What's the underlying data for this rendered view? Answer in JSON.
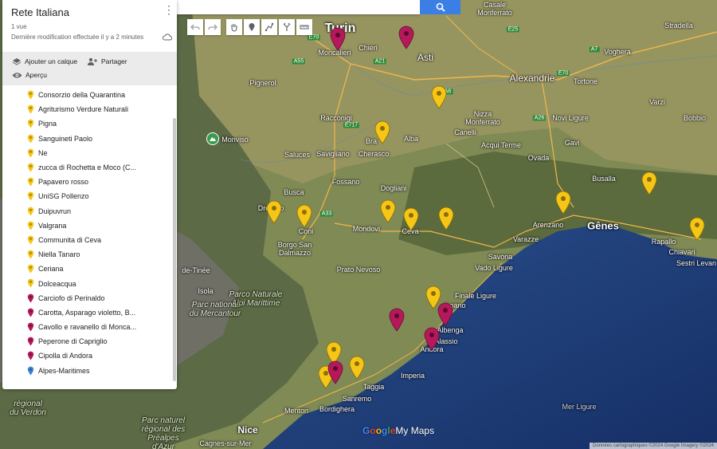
{
  "panel": {
    "title": "Rete Italiana",
    "views": "1 vue",
    "modified": "Dernière modification effectuée il y a 2 minutes",
    "actions": {
      "add_layer": "Ajouter un calque",
      "share": "Partager",
      "preview": "Aperçu"
    },
    "items": [
      {
        "label": "Consorzio della Quarantina",
        "color": "#f5c518"
      },
      {
        "label": "Agriturismo Verdure Naturali",
        "color": "#f5c518"
      },
      {
        "label": "Pigna",
        "color": "#f5c518"
      },
      {
        "label": "Sanguineti Paolo",
        "color": "#f5c518"
      },
      {
        "label": "Ne",
        "color": "#f5c518"
      },
      {
        "label": "zucca di Rochetta e Moco (C...",
        "color": "#f5c518"
      },
      {
        "label": "Papavero rosso",
        "color": "#f5c518"
      },
      {
        "label": "UniSG Pollenzo",
        "color": "#f5c518"
      },
      {
        "label": "Duipuvrun",
        "color": "#f5c518"
      },
      {
        "label": "Valgrana",
        "color": "#f5c518"
      },
      {
        "label": "Communita di Ceva",
        "color": "#f5c518"
      },
      {
        "label": "Niella Tanaro",
        "color": "#f5c518"
      },
      {
        "label": "Ceriana",
        "color": "#f5c518"
      },
      {
        "label": "Dolceacqua",
        "color": "#f5c518"
      },
      {
        "label": "Carciofo di Perinaldo",
        "color": "#b5195b"
      },
      {
        "label": "Carotta, Asparago violetto, B...",
        "color": "#b5195b"
      },
      {
        "label": "Cavollo e ravanello di Monca...",
        "color": "#b5195b"
      },
      {
        "label": "Peperone di Capriglio",
        "color": "#b5195b"
      },
      {
        "label": "Cipolla di Andora",
        "color": "#b5195b"
      },
      {
        "label": "Alpes-Maritimes",
        "color": "#3a86d4"
      }
    ]
  },
  "search": {
    "value": ""
  },
  "map": {
    "places": {
      "turin": "Turin",
      "moncalieri": "Moncalieri",
      "chieri": "Chieri",
      "asti": "Asti",
      "alexandrie": "Alexandrie",
      "casale": "Casale\nMonferrato",
      "voghera": "Voghera",
      "stradella": "Stradella",
      "tortone": "Tortone",
      "novi": "Novi Ligure",
      "varzi": "Varzi",
      "bobbio": "Bobbio",
      "gavi": "Gavi",
      "ovada": "Ovada",
      "acqui": "Acqui Terme",
      "nizza": "Nizza\nMonferrato",
      "canelli": "Canelli",
      "alba": "Alba",
      "bra": "Bra",
      "cherasco": "Cherasco",
      "racconigi": "Racconigi",
      "pignerol": "Pignerol",
      "monviso": "Monviso",
      "saluces": "Saluces",
      "savigliano": "Savigliano",
      "fossano": "Fossano",
      "busca": "Busca",
      "dronero": "Dronero",
      "coni": "Coni",
      "mondovi": "Mondovì",
      "dogliani": "Dogliani",
      "ceva": "Ceva",
      "borgo": "Borgo San\nDalmazzo",
      "arenzano": "Arenzano",
      "genes": "Gênes",
      "rapallo": "Rapallo",
      "chiavari": "Chiavari",
      "sestri": "Sestri Levan",
      "busalla": "Busalla",
      "varazze": "Varazze",
      "savona": "Savona",
      "vado": "Vado Ligure",
      "finale": "Finale Ligure",
      "loano": "Loano",
      "albenga": "Albenga",
      "alassio": "Alassio",
      "andora": "Andora",
      "imperia": "Imperia",
      "taggia": "Taggia",
      "sanremo": "Sanremo",
      "bordighera": "Bordighera",
      "menton": "Menton",
      "nice": "Nice",
      "cagnes": "Cagnes-sur-Mer",
      "prato": "Prato Nevoso",
      "isola": "Isola",
      "tinee": "de-Tinée",
      "park_alpi": "Parco Naturale\nAlpi Marittime",
      "park_mercantour": "Parc national\ndu Mercantour",
      "park_verdon": "régional\ndu Verdon",
      "park_prealpes": "Parc naturel\nrégional des\nPréalpes\nd'Azur",
      "mer": "Mer Ligure"
    },
    "roads": [
      "E70",
      "A55",
      "A21",
      "E25",
      "A7",
      "E717",
      "A33",
      "A6",
      "E70",
      "A26"
    ]
  },
  "logo": {
    "google": [
      "G",
      "o",
      "o",
      "g",
      "l",
      "e"
    ],
    "mymaps": "My Maps"
  },
  "attribution": "Données cartographiques ©2024 Google Imagery ©2024"
}
